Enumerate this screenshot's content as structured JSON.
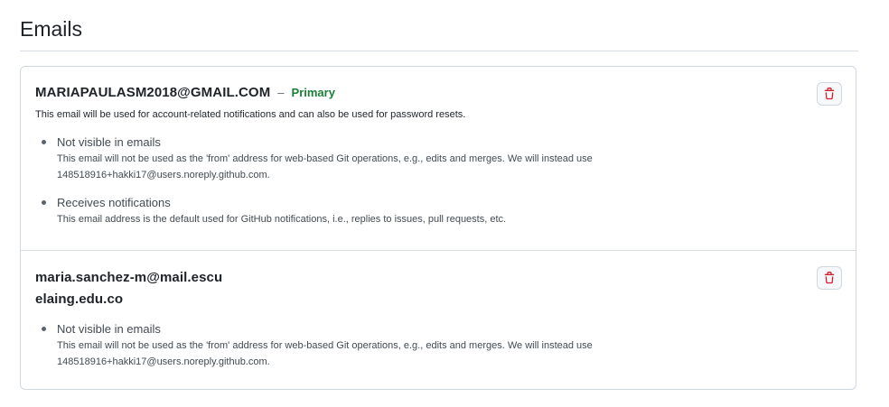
{
  "page": {
    "title": "Emails"
  },
  "emails": [
    {
      "address": "MARIAPAULASM2018@GMAIL.COM",
      "separator": "–",
      "primary_label": "Primary",
      "description": "This email will be used for account-related notifications and can also be used for password resets.",
      "bullets": [
        {
          "title": "Not visible in emails",
          "description": "This email will not be used as the 'from' address for web-based Git operations, e.g., edits and merges. We will instead use 148518916+hakki17@users.noreply.github.com."
        },
        {
          "title": "Receives notifications",
          "description": "This email address is the default used for GitHub notifications, i.e., replies to issues, pull requests, etc."
        }
      ],
      "delete_icon": "trash-icon"
    },
    {
      "address": "maria.sanchez-m@mail.escuelaing.edu.co",
      "bullets": [
        {
          "title": "Not visible in emails",
          "description": "This email will not be used as the 'from' address for web-based Git operations, e.g., edits and merges. We will instead use 148518916+hakki17@users.noreply.github.com."
        }
      ],
      "delete_icon": "trash-icon"
    }
  ],
  "colors": {
    "primary_green": "#1a7f37",
    "danger_red": "#cf222e",
    "border": "#d0d7de"
  }
}
